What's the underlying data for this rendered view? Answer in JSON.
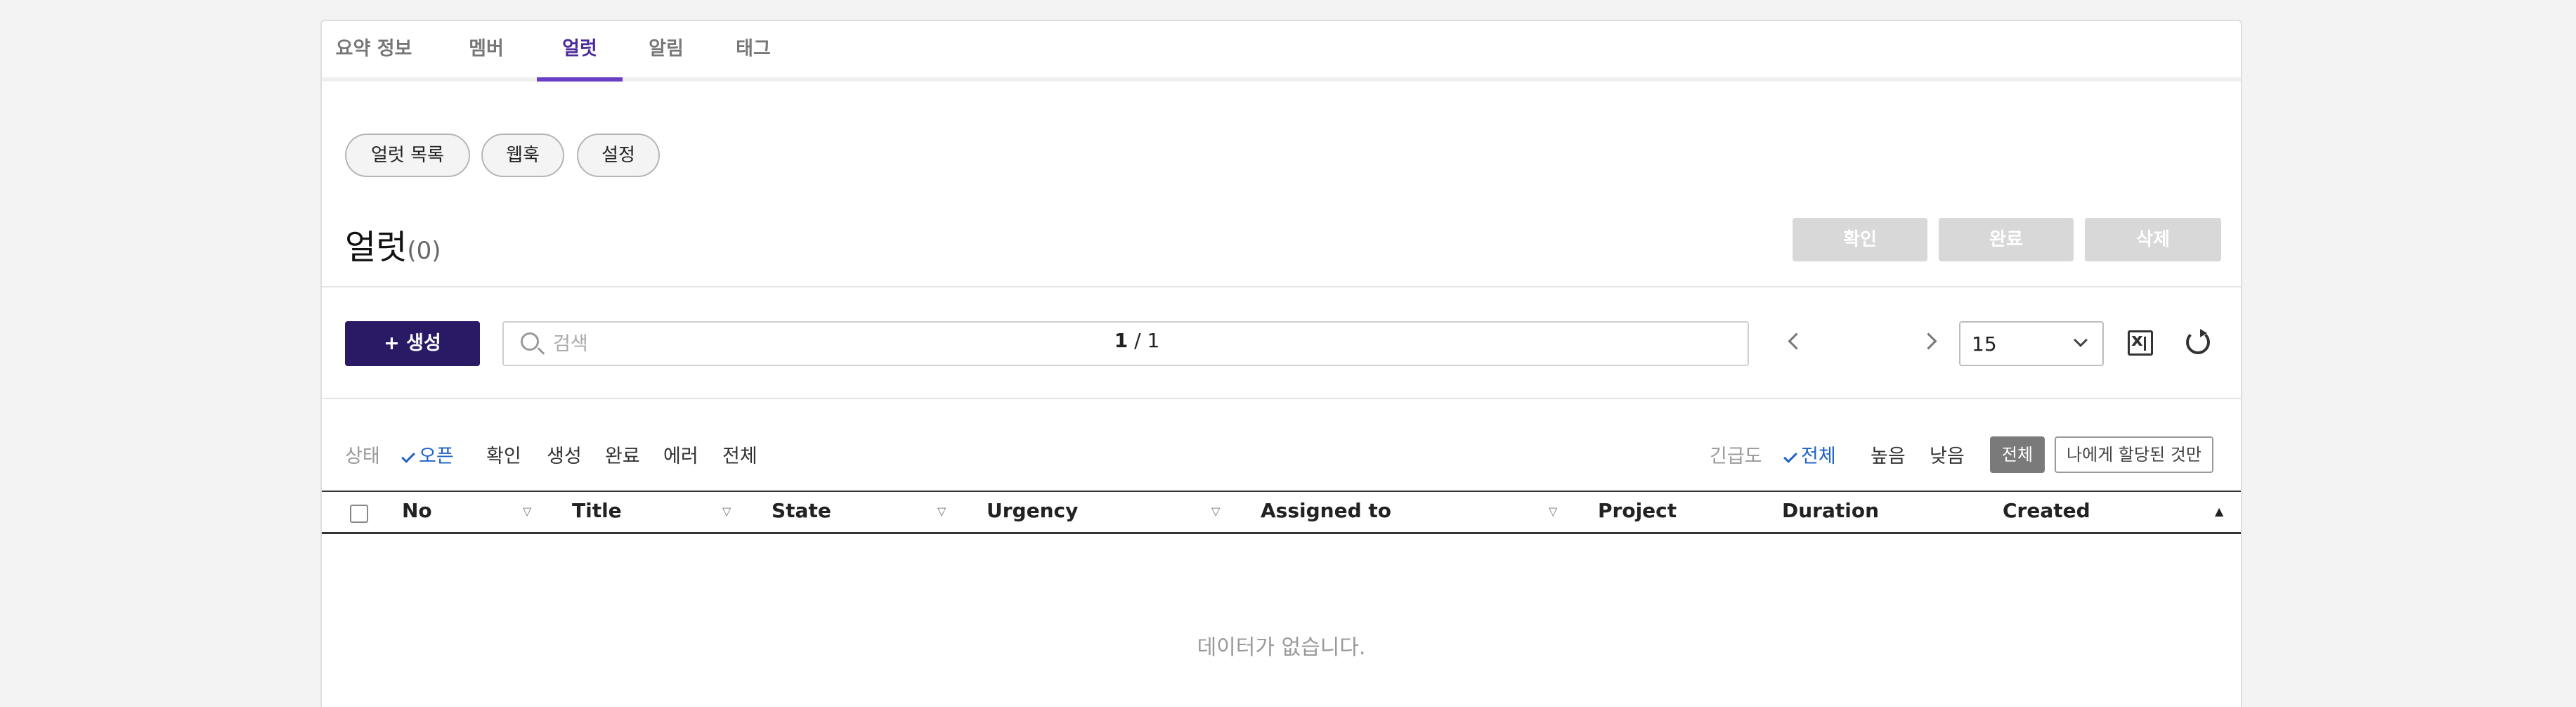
{
  "tabs": [
    {
      "label": "요약 정보"
    },
    {
      "label": "멤버"
    },
    {
      "label": "얼럿"
    },
    {
      "label": "알림"
    },
    {
      "label": "태그"
    }
  ],
  "subtabs": [
    {
      "label": "얼럿 목록"
    },
    {
      "label": "웹훅"
    },
    {
      "label": "설정"
    }
  ],
  "section": {
    "title": "얼럿",
    "count": "(0)"
  },
  "actions": {
    "confirm": "확인",
    "complete": "완료",
    "delete": "삭제"
  },
  "toolbar": {
    "create_label": "+ 생성",
    "search_placeholder": "검색",
    "page_current": "1",
    "page_total": "/ 1",
    "page_size": "15",
    "excel_icon": "excel-icon",
    "refresh_icon": "refresh-icon"
  },
  "status_filter": {
    "label": "상태",
    "options": [
      "오픈",
      "확인",
      "생성",
      "완료",
      "에러",
      "전체"
    ],
    "selected": "오픈"
  },
  "urgency_filter": {
    "label": "긴급도",
    "options": [
      "전체",
      "높음",
      "낮음"
    ],
    "selected": "전체"
  },
  "assign_filter": {
    "all": "전체",
    "mine": "나에게 할당된 것만"
  },
  "table": {
    "columns": [
      "No",
      "Title",
      "State",
      "Urgency",
      "Assigned to",
      "Project",
      "Duration",
      "Created"
    ],
    "rows": [],
    "empty_text": "데이터가 없습니다."
  },
  "colors": {
    "accent": "#6a3fc6",
    "create_button": "#2a1a66",
    "filter_active": "#1f63c6"
  }
}
